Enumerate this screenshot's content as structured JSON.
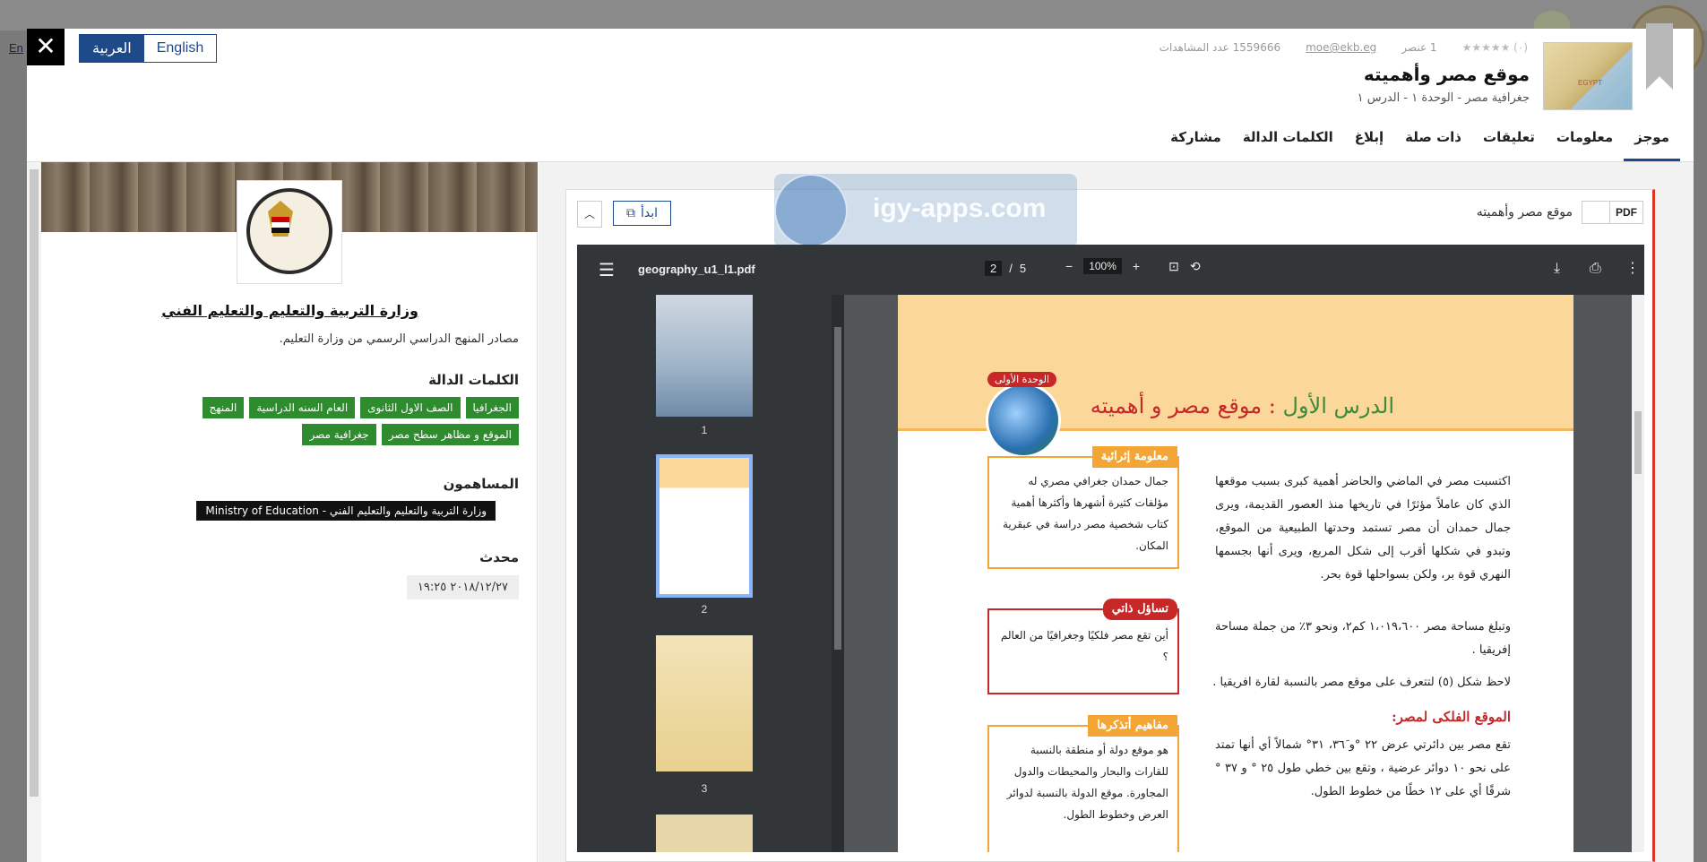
{
  "background": {
    "lang_link": "En"
  },
  "header": {
    "lang_ar": "العربية",
    "lang_en": "English",
    "close_label": "✕",
    "rating": "(٠) ★★★★★",
    "elements": "1 عنصر",
    "email": "moe@ekb.eg",
    "views": "1559666 عدد المشاهدات",
    "title": "موقع مصر وأهميته",
    "subtitle": "جغرافية مصر - الوحدة ١ - الدرس ١",
    "map_label": "EGYPT"
  },
  "tabs": [
    {
      "label": "موجز",
      "active": true
    },
    {
      "label": "معلومات"
    },
    {
      "label": "تعليقات"
    },
    {
      "label": "ذات صلة"
    },
    {
      "label": "إبلاغ"
    },
    {
      "label": "الكلمات الدالة"
    },
    {
      "label": "مشاركة"
    }
  ],
  "left": {
    "publisher": "وزارة التربية والتعليم والتعليم الفني",
    "description": "مصادر المنهج الدراسي الرسمي من وزارة التعليم.",
    "keywords_heading": "الكلمات الدالة",
    "keywords": [
      "الجغرافيا",
      "الصف الاول الثانوى",
      "العام السنه الدراسية",
      "المنهج",
      "الموقع و مظاهر سطح مصر",
      "جغرافية مصر"
    ],
    "contributors_heading": "المساهمون",
    "contributor": "وزارة التربية والتعليم والتعليم الفني - Ministry of Education",
    "updated_heading": "محدث",
    "updated": "٢٠١٨/١٢/٢٧ ١٩:٢٥"
  },
  "viewer": {
    "pdf_badge": "PDF",
    "doc_name": "موقع مصر وأهميته",
    "start_label": "ابدأ",
    "start_icon": "external-link-icon",
    "collapse_icon": "chevron-up-icon",
    "watermark": "igy-apps.com",
    "file_name": "geography_u1_l1.pdf",
    "page_current": "2",
    "page_sep": "/",
    "page_total": "5",
    "zoom": "100%",
    "thumbs": [
      "1",
      "2",
      "3"
    ]
  },
  "page": {
    "unit_pill": "الوحدة الأولى",
    "lesson_no": "الدرس الأول",
    "lesson_sep": ":",
    "lesson_title": "موقع مصر و أهميته",
    "para1": "اكتسبت مصر في الماضي والحاضر أهمية كبرى بسبب موقعها الذي كان عاملاً مؤثرًا في تاريخها منذ العصور القديمة، ويرى جمال حمدان أن مصر تستمد وحدتها الطبيعية من الموقع، وتبدو في شكلها أقرب إلى شكل المربع، ويرى أنها بجسمها النهري قوة بر، ولكن بسواحلها قوة بحر.",
    "para2": "وتبلغ مساحة مصر ١،٠١٩،٦٠٠ كم٢، ونحو ٣٪ من جملة مساحة إفريقيا .",
    "para3": "لاحظ شكل (٥) لتتعرف على موقع مصر بالنسبة لقارة افريقيا .",
    "h_astro": "الموقع الفلكى لمصر:",
    "para4": "تقع مصر بين دائرتي عرض ٢٢ °و ٣٦َ، ٣١° شمالاً أي أنها تمتد على نحو ١٠ دوائر عرضية ، وتقع بين خطي طول ٢٥ ° و ٣٧ ° شرقًا أي على ١٢ خطًا من خطوط الطول.",
    "info_h": "معلومة إثرائية",
    "info_body": "جمال حمدان جغرافي مصري له مؤلفات كثيرة أشهرها وأكثرها أهمية كتاب شخصية مصر دراسة في عبقرية المكان.",
    "q_h": "تساؤل ذاتي",
    "q_body": "أين تقع مصر فلكيًا وجغرافيًا من العالم ؟",
    "c_h": "مفاهيم أتذكرها",
    "c_body": "هو موقع دولة أو منطقة بالنسبة للقارات والبحار والمحيطات والدول المجاورة. موقع الدولة بالنسبة لدوائر العرض وخطوط الطول."
  }
}
